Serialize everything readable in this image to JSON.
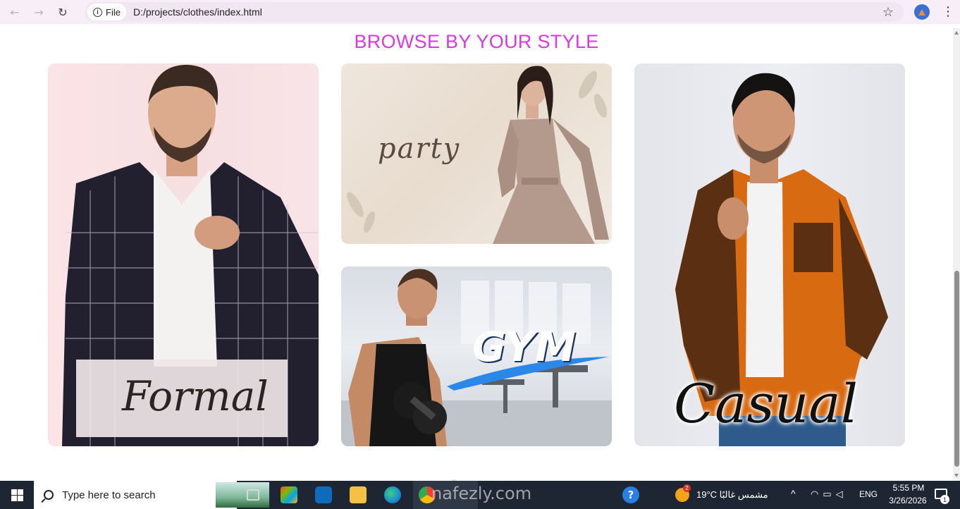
{
  "browser": {
    "back_icon": "arrow-left-icon",
    "forward_icon": "arrow-right-icon",
    "reload_icon": "reload-icon",
    "site_chip_label": "File",
    "url": "D:/projects/clothes/index.html",
    "bookmark_icon": "star-icon",
    "menu_glyph": "⋮"
  },
  "page": {
    "section_title": "BROWSE BY YOUR STYLE",
    "title_color": "#d63ae0",
    "cards": {
      "formal": {
        "label": "Formal"
      },
      "party": {
        "label": "party"
      },
      "gym": {
        "label": "GYM"
      },
      "casual": {
        "label": "Casual"
      }
    },
    "watermark": "نفذلي"
  },
  "taskbar": {
    "search_placeholder": "Type here to search",
    "weather_temp": "19°C",
    "weather_desc": "مشمس غالبًا",
    "weather_badge": "2",
    "language": "ENG",
    "time": "5:55 PM",
    "date": "3/26/2026",
    "notification_count": "1",
    "watermark": "nafezly.com",
    "help_glyph": "?"
  }
}
